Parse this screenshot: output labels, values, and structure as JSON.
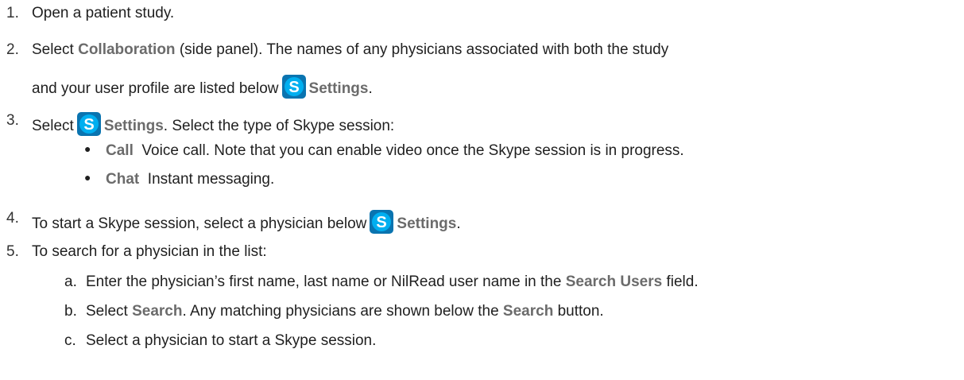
{
  "steps": [
    {
      "num": "1.",
      "text": "Open a patient study."
    },
    {
      "num": "2.",
      "pre": "Select ",
      "bold": "Collaboration",
      "post": " (side panel). The names of any physicians associated with both the study",
      "line2_pre": "and your user profile are listed below",
      "line2_bold": "Settings",
      "line2_post": "."
    },
    {
      "num": "3.",
      "pre": "Select",
      "bold": "Settings",
      "post": ". Select the type of Skype session:",
      "bullets": [
        {
          "term": "Call",
          "desc": "Voice call. Note that you can enable video once the Skype session is in progress."
        },
        {
          "term": "Chat",
          "desc": "Instant messaging."
        }
      ]
    },
    {
      "num": "4.",
      "pre": "To start a Skype session, select a physician below",
      "bold": "Settings",
      "post": "."
    },
    {
      "num": "5.",
      "text": "To search for a physician in the list:",
      "substeps": [
        {
          "letter": "a.",
          "pre": "Enter the physician’s first name, last name or NilRead user name in the ",
          "bold": "Search Users",
          "post": " field."
        },
        {
          "letter": "b.",
          "pre": "Select ",
          "bold": "Search",
          "mid": ". Any matching physicians are shown below the ",
          "bold2": "Search",
          "post": " button."
        },
        {
          "letter": "c.",
          "pre": "Select a physician to start a Skype session."
        }
      ]
    }
  ],
  "icon": {
    "name": "skype-icon",
    "color": "#00aff0",
    "letter": "S"
  }
}
